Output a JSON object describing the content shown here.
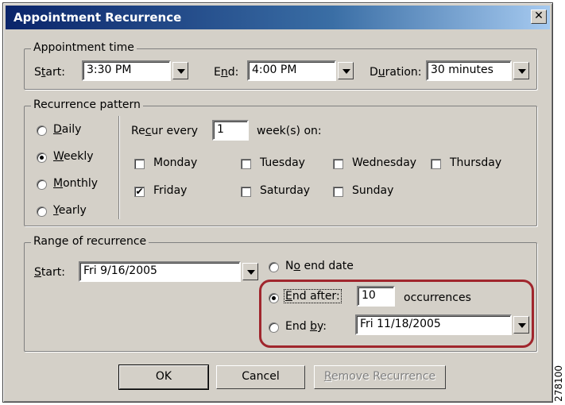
{
  "window": {
    "title": "Appointment Recurrence",
    "close_glyph": "✕"
  },
  "appointment_time": {
    "legend": "Appointment time",
    "start_label_pre": "S",
    "start_label_u": "t",
    "start_label_post": "art:",
    "start_value": "3:30 PM",
    "end_label_pre": "E",
    "end_label_u": "n",
    "end_label_post": "d:",
    "end_value": "4:00 PM",
    "duration_label_pre": "D",
    "duration_label_u": "u",
    "duration_label_post": "ration:",
    "duration_value": "30 minutes"
  },
  "recurrence_pattern": {
    "legend": "Recurrence pattern",
    "options": [
      {
        "pre": "",
        "u": "D",
        "post": "aily",
        "selected": false
      },
      {
        "pre": "",
        "u": "W",
        "post": "eekly",
        "selected": true
      },
      {
        "pre": "",
        "u": "M",
        "post": "onthly",
        "selected": false
      },
      {
        "pre": "",
        "u": "Y",
        "post": "early",
        "selected": false
      }
    ],
    "recur_pre": "Re",
    "recur_u": "c",
    "recur_post": "ur every",
    "recur_value": "1",
    "weeks_on": "week(s) on:",
    "days": [
      {
        "label": "Monday",
        "checked": false
      },
      {
        "label": "Tuesday",
        "checked": false
      },
      {
        "label": "Wednesday",
        "checked": false
      },
      {
        "label": "Thursday",
        "checked": false
      },
      {
        "label": "Friday",
        "checked": true
      },
      {
        "label": "Saturday",
        "checked": false
      },
      {
        "label": "Sunday",
        "checked": false
      }
    ]
  },
  "range": {
    "legend": "Range of recurrence",
    "start_label_pre": "",
    "start_label_u": "S",
    "start_label_post": "tart:",
    "start_value": "Fri 9/16/2005",
    "no_end_pre": "N",
    "no_end_u": "o",
    "no_end_post": " end date",
    "end_after_pre": "",
    "end_after_u": "E",
    "end_after_post": "nd after:",
    "end_after_value": "10",
    "occurrences": "occurrences",
    "end_by_pre": "End ",
    "end_by_u": "b",
    "end_by_post": "y:",
    "end_by_value": "Fri 11/18/2005",
    "selected": "end_after"
  },
  "buttons": {
    "ok": "OK",
    "cancel": "Cancel",
    "remove_pre": "",
    "remove_u": "R",
    "remove_post": "emove Recurrence"
  },
  "side_code": "278100",
  "colors": {
    "highlight": "#a0262d",
    "titlebar": "#0a246a"
  }
}
